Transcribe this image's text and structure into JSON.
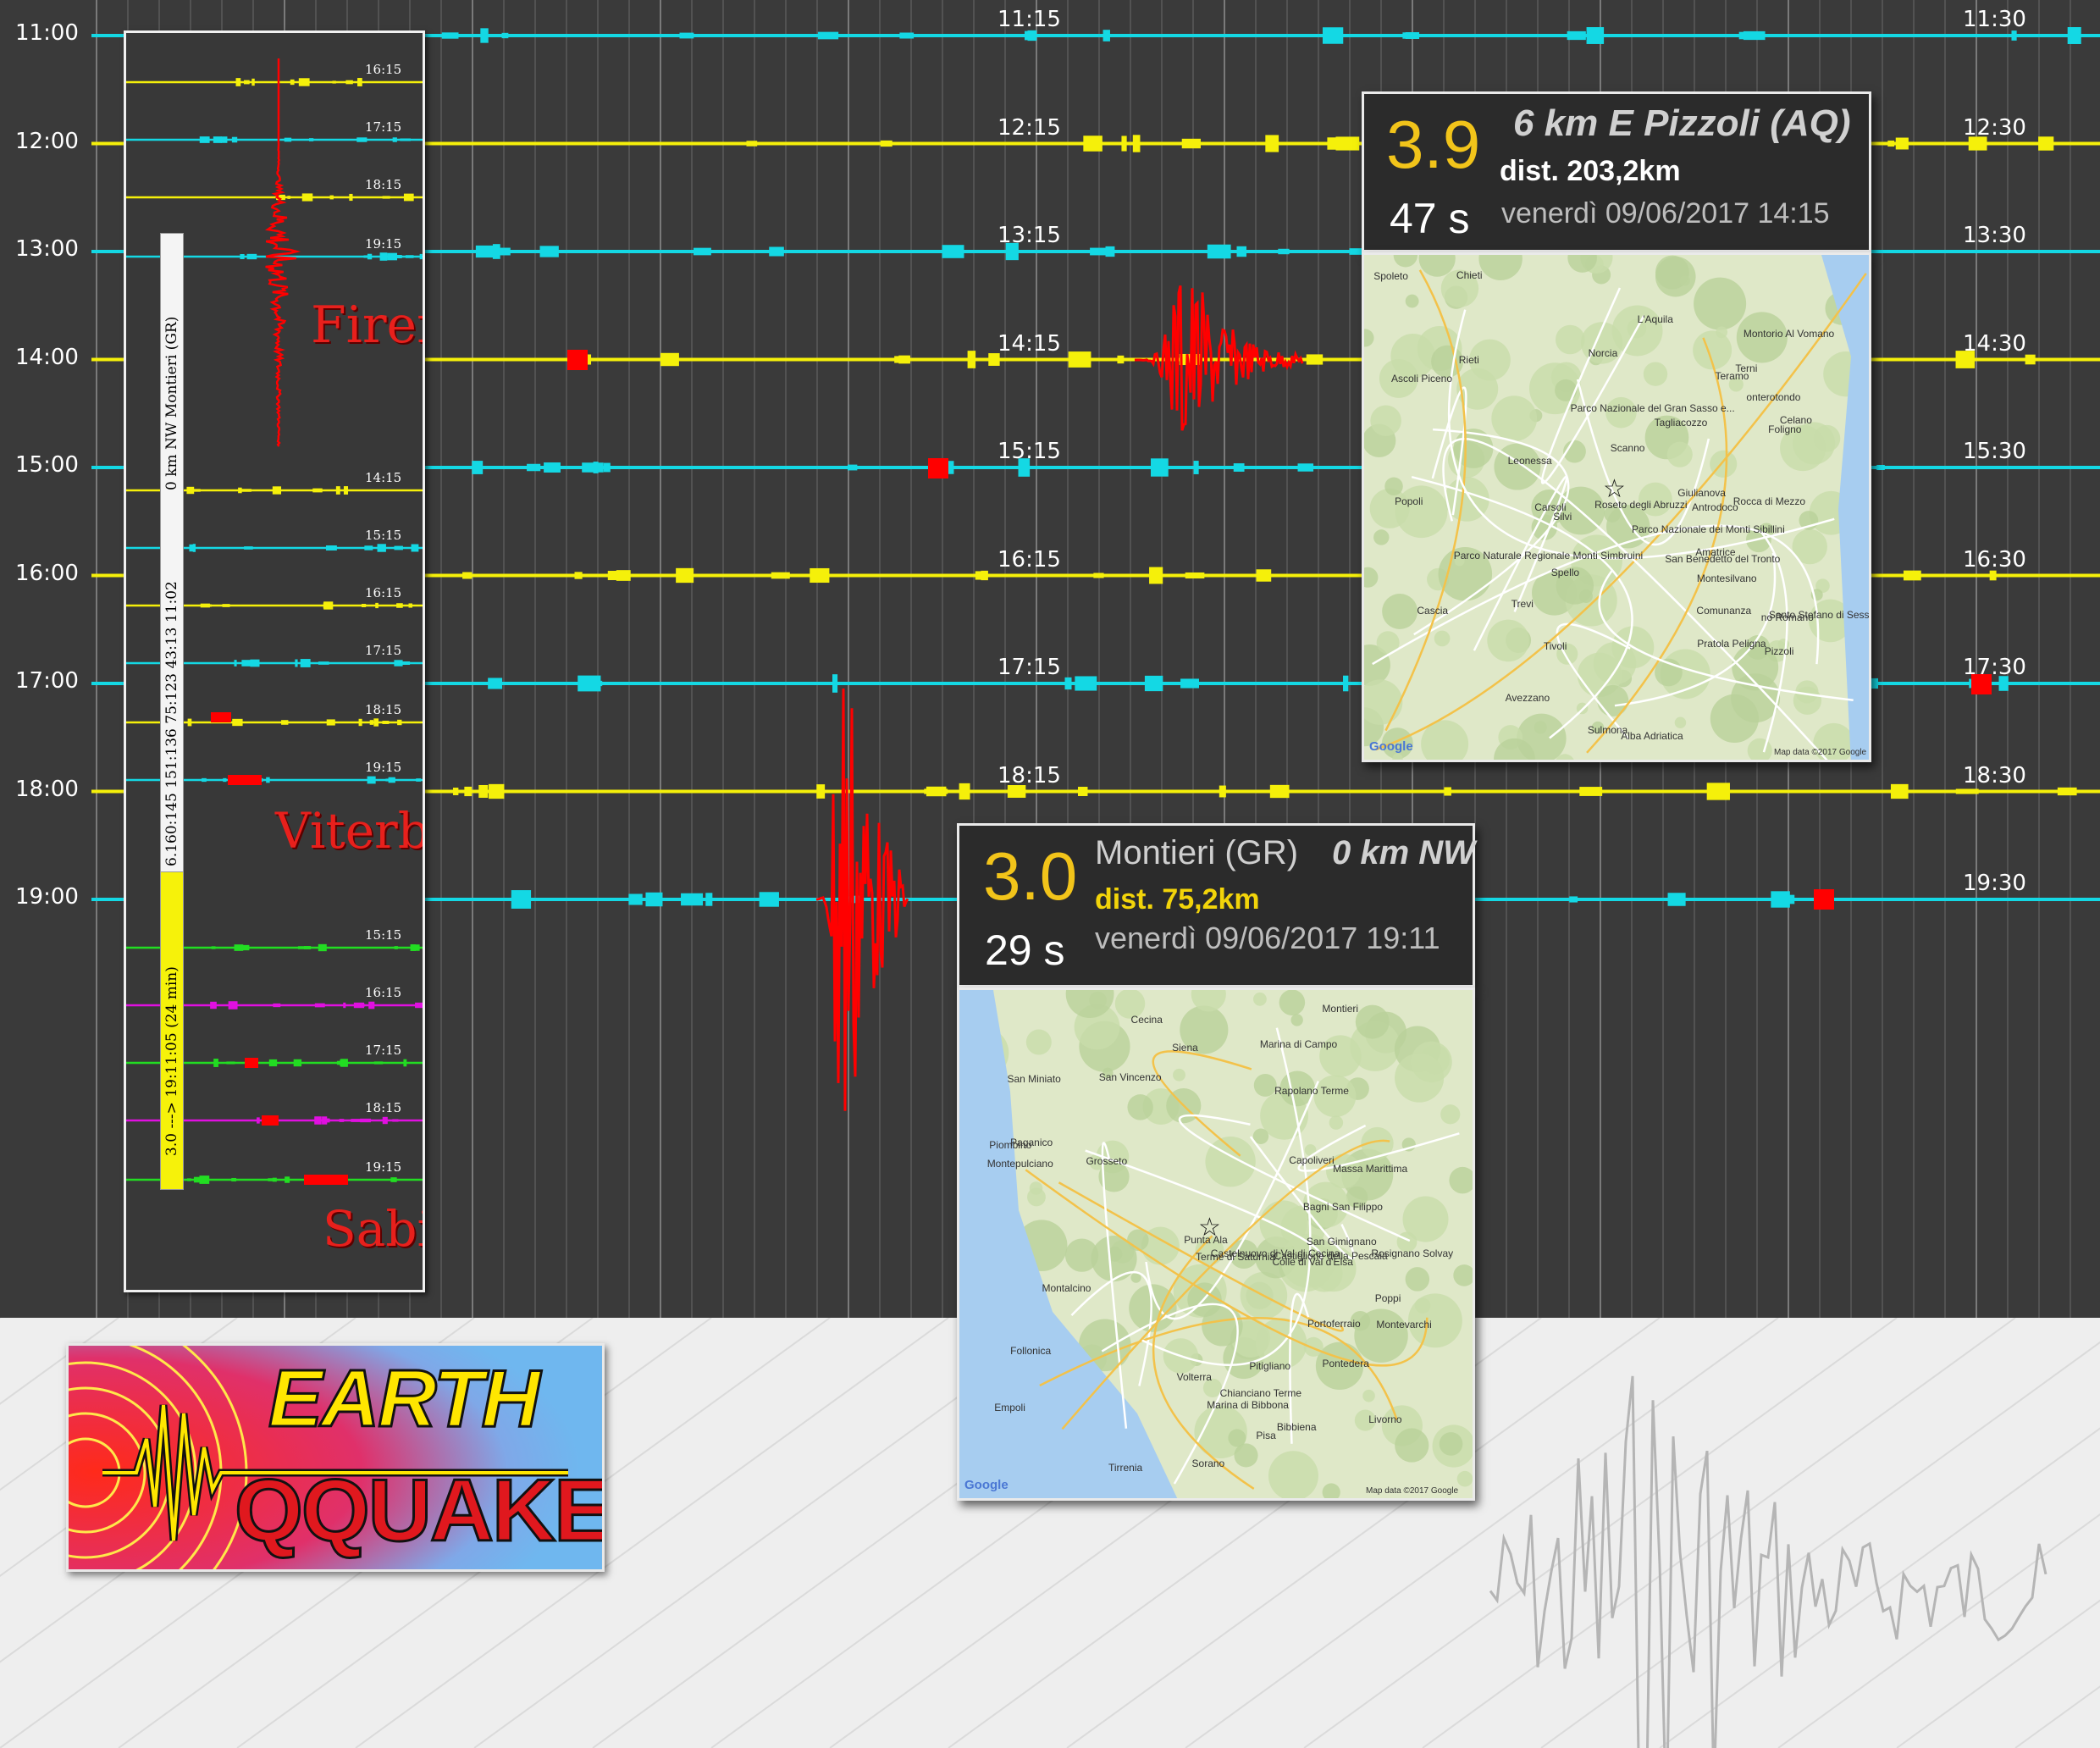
{
  "time_axis": {
    "left_hours": [
      "11:00",
      "12:00",
      "13:00",
      "14:00",
      "15:00",
      "16:00",
      "17:00",
      "18:00",
      "19:00"
    ],
    "mid_marks": [
      "11:15",
      "12:15",
      "13:15",
      "14:15",
      "15:15",
      "16:15",
      "17:15",
      "18:15"
    ],
    "right_marks": [
      "11:30",
      "12:30",
      "13:30",
      "14:30",
      "15:30",
      "16:30",
      "17:30",
      "18:30",
      "19:30"
    ]
  },
  "stations_panel": {
    "stations": [
      "Firenze",
      "Viterbo",
      "Sabina"
    ],
    "mini_times": [
      "16:15",
      "17:15",
      "18:15",
      "19:15",
      "14:15",
      "15:15",
      "16:15",
      "17:15",
      "18:15",
      "19:15",
      "15:15",
      "16:15",
      "17:15",
      "18:15",
      "19:15"
    ],
    "vertical_bar": {
      "text_top": "0 km NW Montieri (GR)",
      "text_mid": "6.160:145 151:136 75:123 43:13 11:02",
      "text_bottom": "3.0 ---> 19:11:05 (24 min)"
    }
  },
  "event_pizzoli": {
    "magnitude": "3.9",
    "place": "6 km E Pizzoli (AQ)",
    "distance": "dist. 203,2km",
    "duration": "47 s",
    "datetime": "venerdì 09/06/2017 14:15",
    "map_labels": [
      "Spello",
      "Foligno",
      "Trevi",
      "Parco Nazionale dei Monti Sibillini",
      "Comunanza",
      "San Benedetto del Tronto",
      "Ascoli Piceno",
      "Alba Adriatica",
      "Norcia",
      "Spoleto",
      "Giulianova",
      "Cascia",
      "Teramo",
      "Roseto degli Abruzzi",
      "Amatrice",
      "Terni",
      "Leonessa",
      "Montorio Al Vomano",
      "Parco Nazionale del Gran Sasso e...",
      "Silvi",
      "Montesilvano",
      "Pizzoli",
      "Rieti",
      "Antrodoco",
      "L'Aquila",
      "Santo Stefano di Sessanio",
      "Chieti",
      "Rocca di Mezzo",
      "Popoli",
      "Carsoli",
      "Celano",
      "Pratola Peligna",
      "Tagliacozzo",
      "Avezzano",
      "Sulmona",
      "Tivoli",
      "Parco Naturale Regionale Monti Simbruini",
      "Scanno",
      "onterotondo",
      "no Romano"
    ],
    "google": "Google",
    "map_data": "Map data ©2017 Google"
  },
  "event_montieri": {
    "magnitude": "3.0",
    "place_regular": "Montieri (GR)",
    "place_bold": "0 km NW",
    "distance": "dist. 75,2km",
    "duration": "29 s",
    "datetime": "venerdì 09/06/2017 19:11",
    "map_labels": [
      "Pisa",
      "Empoli",
      "Poppi",
      "Bibbiena",
      "Pontedera",
      "San Miniato",
      "Tirrenia",
      "Livorno",
      "Montevarchi",
      "San Gimignano",
      "Colle di Val d'Elsa",
      "Rosignano Solvay",
      "Volterra",
      "Siena",
      "Cecina",
      "Rapolano Terme",
      "Marina di Bibbona",
      "Castelnuovo di Val di Cecina",
      "Montieri",
      "San Vincenzo",
      "Massa Marittima",
      "Montalcino",
      "Montepulciano",
      "Chianciano Terme",
      "Piombino",
      "Follonica",
      "Paganico",
      "Bagni San Filippo",
      "Portoferraio",
      "Marina di Campo",
      "Capoliveri",
      "Punta Ala",
      "Castiglione della Pescaia",
      "Grosseto",
      "Terme di Saturnia",
      "Sorano",
      "Pitigliano"
    ],
    "google": "Google",
    "map_data": "Map data ©2017 Google"
  },
  "logo": {
    "line1": "EARTH",
    "line2": "QQUAKE"
  },
  "colors": {
    "cyan_trace": "#14d8e4",
    "yellow_trace": "#f5f00a",
    "event_red": "#ff0000",
    "green_trace": "#22dd22",
    "magenta_trace": "#e010e0",
    "bg_dark": "#3a3a3a",
    "mag_yellow": "#f2c41a"
  }
}
